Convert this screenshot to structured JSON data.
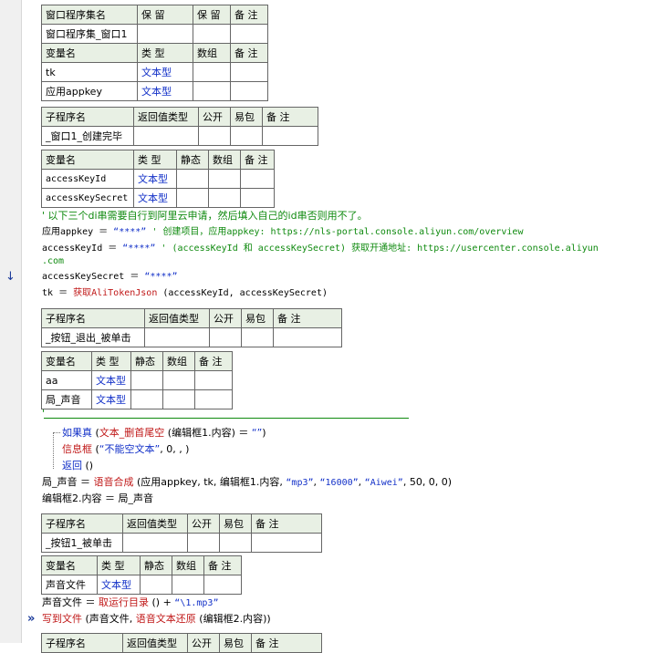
{
  "t1": {
    "header": [
      "窗口程序集名",
      "保 留",
      "保 留",
      "备 注"
    ],
    "row": [
      "窗口程序集_窗口1",
      "",
      "",
      ""
    ],
    "var_header": [
      "变量名",
      "类 型",
      "数组",
      "备 注"
    ],
    "vars": [
      [
        "tk",
        "文本型",
        "",
        ""
      ],
      [
        "应用appkey",
        "文本型",
        "",
        ""
      ]
    ]
  },
  "t2": {
    "header": [
      "子程序名",
      "返回值类型",
      "公开",
      "易包",
      "备 注"
    ],
    "row": [
      "_窗口1_创建完毕",
      "",
      "",
      "",
      ""
    ]
  },
  "t3": {
    "header": [
      "变量名",
      "类 型",
      "静态",
      "数组",
      "备 注"
    ],
    "vars": [
      [
        "accessKeyId",
        "文本型",
        "",
        "",
        ""
      ],
      [
        "accessKeySecret",
        "文本型",
        "",
        "",
        ""
      ]
    ]
  },
  "code1": {
    "comment": "' 以下三个di串需要自行到阿里云申请，然后填入自己的id串否则用不了。",
    "l1_var": "应用appkey",
    "l1_eq": " ＝ ",
    "l1_str": "“****”",
    "l1_cm": " ' 创建项目，应用appkey: https://nls-portal.console.aliyun.com/overview",
    "l2_var": "accessKeyId",
    "l2_eq": " ＝ ",
    "l2_str": "“****”",
    "l2_cm": " ' (accessKeyId 和 accessKeySecret) 获取开通地址: https://usercenter.console.aliyun",
    "l2_wrap": ".com",
    "l3_var": "accessKeySecret",
    "l3_eq": " ＝ ",
    "l3_str": "“****”",
    "l4_var": "tk",
    "l4_eq": " ＝ ",
    "l4_fn": "获取AliTokenJson",
    "l4_args": " (accessKeyId, accessKeySecret)"
  },
  "t4": {
    "header": [
      "子程序名",
      "返回值类型",
      "公开",
      "易包",
      "备 注"
    ],
    "row": [
      "_按钮_退出_被单击",
      "",
      "",
      "",
      ""
    ]
  },
  "t5": {
    "header": [
      "变量名",
      "类 型",
      "静态",
      "数组",
      "备 注"
    ],
    "vars": [
      [
        "aa",
        "文本型",
        "",
        "",
        ""
      ],
      [
        "局_声音",
        "文本型",
        "",
        "",
        ""
      ]
    ]
  },
  "code2": {
    "sep_mark": "'",
    "if_kw": "如果真",
    "if_open": " (",
    "if_fn": "文本_删首尾空",
    "if_rest": " (编辑框1.内容) ＝ ",
    "if_str": "“”",
    "if_close": ")",
    "msg_fn": "信息框",
    "msg_open": " (",
    "msg_str": "“不能空文本”",
    "msg_rest": ", 0, , )",
    "ret_kw": "返回",
    "ret_rest": " ()",
    "s1_var": "局_声音",
    "s1_eq": " ＝ ",
    "s1_fn": "语音合成",
    "s1_a": " (应用appkey, tk, 编辑框1.内容, ",
    "s1_s1": "“mp3”",
    "s1_c1": ", ",
    "s1_s2": "“16000”",
    "s1_c2": ", ",
    "s1_s3": "“Aiwei”",
    "s1_end": ", 50, 0, 0)",
    "s2": "编辑框2.内容 ＝ 局_声音"
  },
  "t6": {
    "header": [
      "子程序名",
      "返回值类型",
      "公开",
      "易包",
      "备 注"
    ],
    "row": [
      "_按钮1_被单击",
      "",
      "",
      "",
      ""
    ]
  },
  "t7": {
    "header": [
      "变量名",
      "类 型",
      "静态",
      "数组",
      "备 注"
    ],
    "vars": [
      [
        "声音文件",
        "文本型",
        "",
        "",
        ""
      ]
    ]
  },
  "code3": {
    "l1_var": "声音文件",
    "l1_eq": " ＝ ",
    "l1_fn": "取运行目录",
    "l1_mid": " () + ",
    "l1_str": "“\\1.mp3”",
    "l2_fn": "写到文件",
    "l2_a": " (声音文件, ",
    "l2_fn2": "语音文本还原",
    "l2_b": " (编辑框2.内容))"
  },
  "t8": {
    "header": [
      "子程序名",
      "返回值类型",
      "公开",
      "易包",
      "备 注"
    ]
  },
  "marks": {
    "arrow_down": "↓",
    "arrow_right": "»"
  }
}
